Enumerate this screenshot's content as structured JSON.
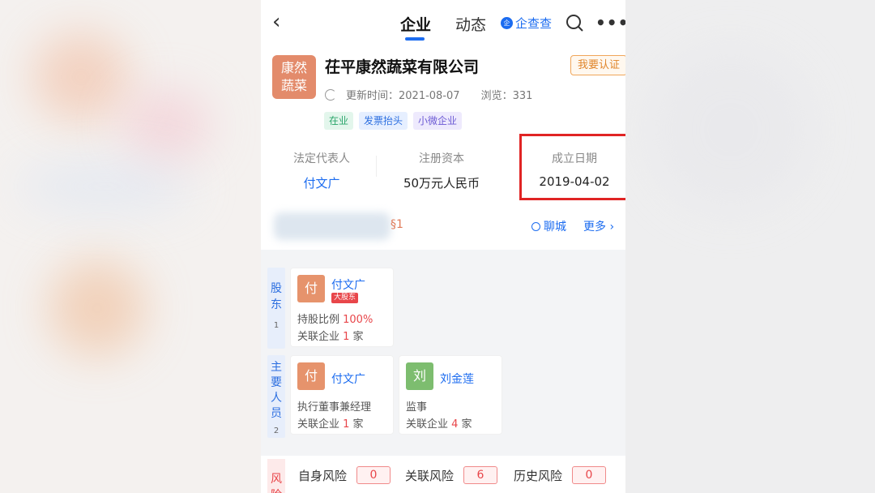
{
  "nav": {
    "back_icon": "chevron-left-icon",
    "tabs": [
      {
        "label": "企业",
        "active": true
      },
      {
        "label": "动态",
        "active": false
      }
    ],
    "brand_badge": "企",
    "brand_label": "企查查",
    "search_icon": "search-icon",
    "more_icon": "more-icon",
    "more_glyph": "•••"
  },
  "company": {
    "logo_text_line1": "康然",
    "logo_text_line2": "蔬菜",
    "name": "茌平康然蔬菜有限公司",
    "cert_button": "我要认证",
    "updated": "更新时间：2021-08-07",
    "views": "浏览：331",
    "tags": [
      "在业",
      "发票抬头",
      "小微企业"
    ]
  },
  "key_info": [
    {
      "key": "法定代表人",
      "value": "付文广"
    },
    {
      "key": "注册资本",
      "value": "50万元人民币"
    },
    {
      "key": "成立日期",
      "value": "2019-04-02"
    }
  ],
  "address": {
    "tail": "§1",
    "location": "聊城",
    "more": "更多 ›"
  },
  "shareholders": {
    "label": "股东",
    "count": "1",
    "items": [
      {
        "avatar": "付",
        "name": "付文广",
        "badge": "大股东",
        "ratio_label": "持股比例 ",
        "ratio": "100%",
        "related_label": "关联企业 ",
        "related_count": "1",
        "related_unit": " 家"
      }
    ]
  },
  "staff": {
    "label": "主要人员",
    "count": "2",
    "items": [
      {
        "avatar": "付",
        "name": "付文广",
        "role": "执行董事兼经理",
        "related_label": "关联企业 ",
        "related_count": "1",
        "related_unit": " 家"
      },
      {
        "avatar": "刘",
        "name": "刘金莲",
        "role": "监事",
        "related_label": "关联企业 ",
        "related_count": "4",
        "related_unit": " 家"
      }
    ]
  },
  "risk": {
    "label": "风险",
    "items": [
      {
        "label": "自身风险",
        "value": "0"
      },
      {
        "label": "关联风险",
        "value": "6"
      },
      {
        "label": "历史风险",
        "value": "0"
      }
    ]
  },
  "colors": {
    "accent": "#1c6cf0",
    "highlight_border": "#e02424",
    "logo_bg": "#e38b6b"
  }
}
